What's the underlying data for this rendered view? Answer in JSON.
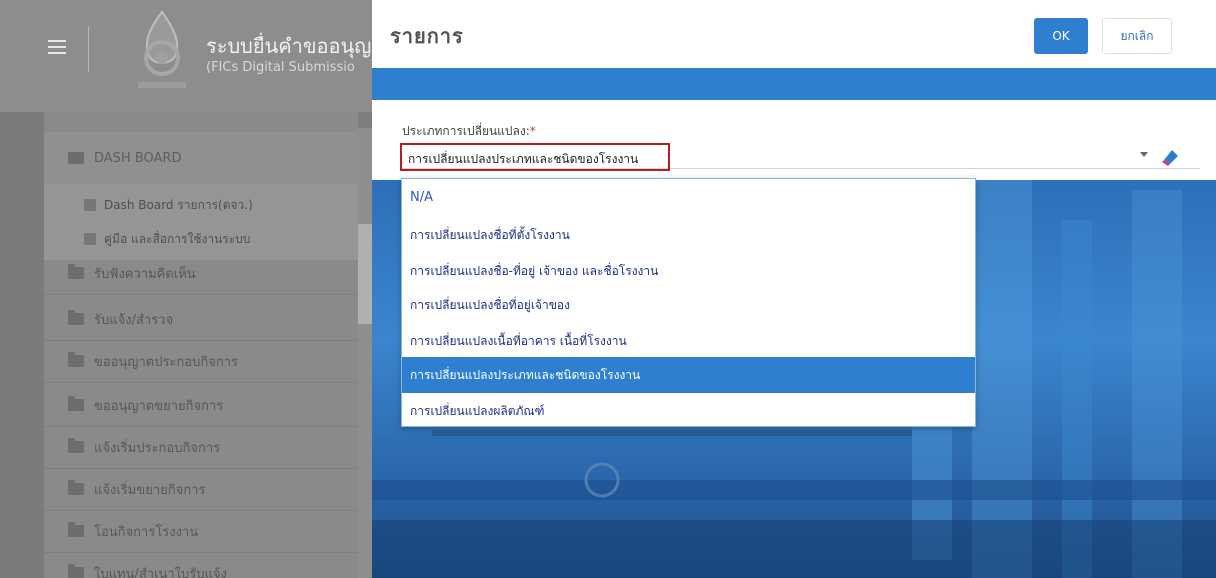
{
  "app": {
    "title": "ระบบยื่นคำขออนุญ",
    "subtitle": "(FICs Digital Submissio"
  },
  "sidebar": {
    "items": [
      {
        "label": "DASH BOARD"
      },
      {
        "label": "รับฟังความคิดเห็น"
      },
      {
        "label": "รับแจ้ง/สำรวจ"
      },
      {
        "label": "ขออนุญาตประกอบกิจการ"
      },
      {
        "label": "ขออนุญาตขยายกิจการ"
      },
      {
        "label": "แจ้งเริ่มประกอบกิจการ"
      },
      {
        "label": "แจ้งเริ่มขยายกิจการ"
      },
      {
        "label": "โอนกิจการโรงงาน"
      },
      {
        "label": "ใบแทน/สำเนาใบรับแจ้ง"
      }
    ],
    "subitems": [
      {
        "label": "Dash Board รายการ(ตจว.)"
      },
      {
        "label": "คู่มือ และสื่อการใช้งานระบบ"
      }
    ]
  },
  "modal": {
    "title": "รายการ",
    "ok_label": "OK",
    "cancel_label": "ยกเลิก",
    "field_label": "ประเภทการเปลี่ยนแปลง:",
    "required_mark": "*",
    "selected_value": "การเปลี่ยนแปลงประเภทและชนิดของโรงงาน"
  },
  "dropdown": {
    "options": [
      "N/A",
      "การเปลี่ยนแปลงชื่อที่ตั้งโรงงาน",
      "การเปลี่ยนแปลงชื่อ-ที่อยู่ เจ้าของ และชื่อโรงงาน",
      "การเปลี่ยนแปลงชื่อที่อยู่เจ้าของ",
      "การเปลี่ยนแปลงเนื้อที่อาคาร เนื้อที่โรงงาน",
      "การเปลี่ยนแปลงประเภทและชนิดของโรงงาน",
      "การเปลี่ยนแปลงผลิตภัณฑ์"
    ],
    "selected_index": 5
  },
  "colors": {
    "primary": "#2f7fd0",
    "highlight_border": "#b32020",
    "option_text": "#1f2f8a"
  },
  "icons": [
    "hamburger-icon",
    "logo-icon",
    "folder-icon",
    "chevron-down-icon",
    "eraser-icon"
  ]
}
